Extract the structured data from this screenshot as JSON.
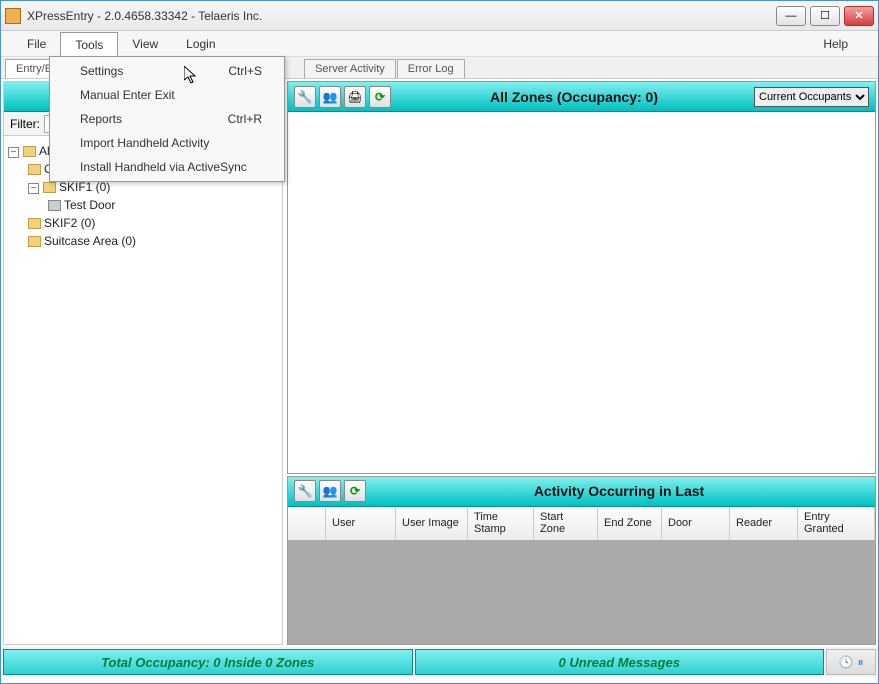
{
  "titlebar": {
    "text": "XPressEntry - 2.0.4658.33342 - Telaeris Inc."
  },
  "menubar": {
    "file": "File",
    "tools": "Tools",
    "view": "View",
    "login": "Login",
    "help": "Help"
  },
  "tools_menu": {
    "settings": {
      "label": "Settings",
      "shortcut": "Ctrl+S"
    },
    "manual": {
      "label": "Manual Enter Exit",
      "shortcut": ""
    },
    "reports": {
      "label": "Reports",
      "shortcut": "Ctrl+R"
    },
    "import": {
      "label": "Import Handheld Activity",
      "shortcut": ""
    },
    "install": {
      "label": "Install Handheld via ActiveSync",
      "shortcut": ""
    }
  },
  "tabs": {
    "entry_exit": "Entry/E",
    "server": "Server Activity",
    "error": "Error Log"
  },
  "filter": {
    "label": "Filter:",
    "value": ""
  },
  "tree": {
    "all": "All",
    "outside": "Outside (0)",
    "skif1": "SKIF1 (0)",
    "test_door": "Test Door",
    "skif2": "SKIF2 (0)",
    "suitcase": "Suitcase Area (0)"
  },
  "zones": {
    "title": "All Zones (Occupancy: 0)",
    "select": "Current Occupants",
    "icons": {
      "settings": "settings-icon",
      "people": "people-icon",
      "print": "print-icon",
      "refresh": "refresh-icon"
    }
  },
  "activity": {
    "title": "Activity Occurring in Last",
    "columns": {
      "c0": "",
      "c1": "User",
      "c2": "User Image",
      "c3": "Time Stamp",
      "c4": "Start Zone",
      "c5": "End Zone",
      "c6": "Door",
      "c7": "Reader",
      "c8": "Entry Granted"
    }
  },
  "status": {
    "occupancy": "Total Occupancy: 0 Inside 0 Zones",
    "messages": "0 Unread Messages"
  }
}
